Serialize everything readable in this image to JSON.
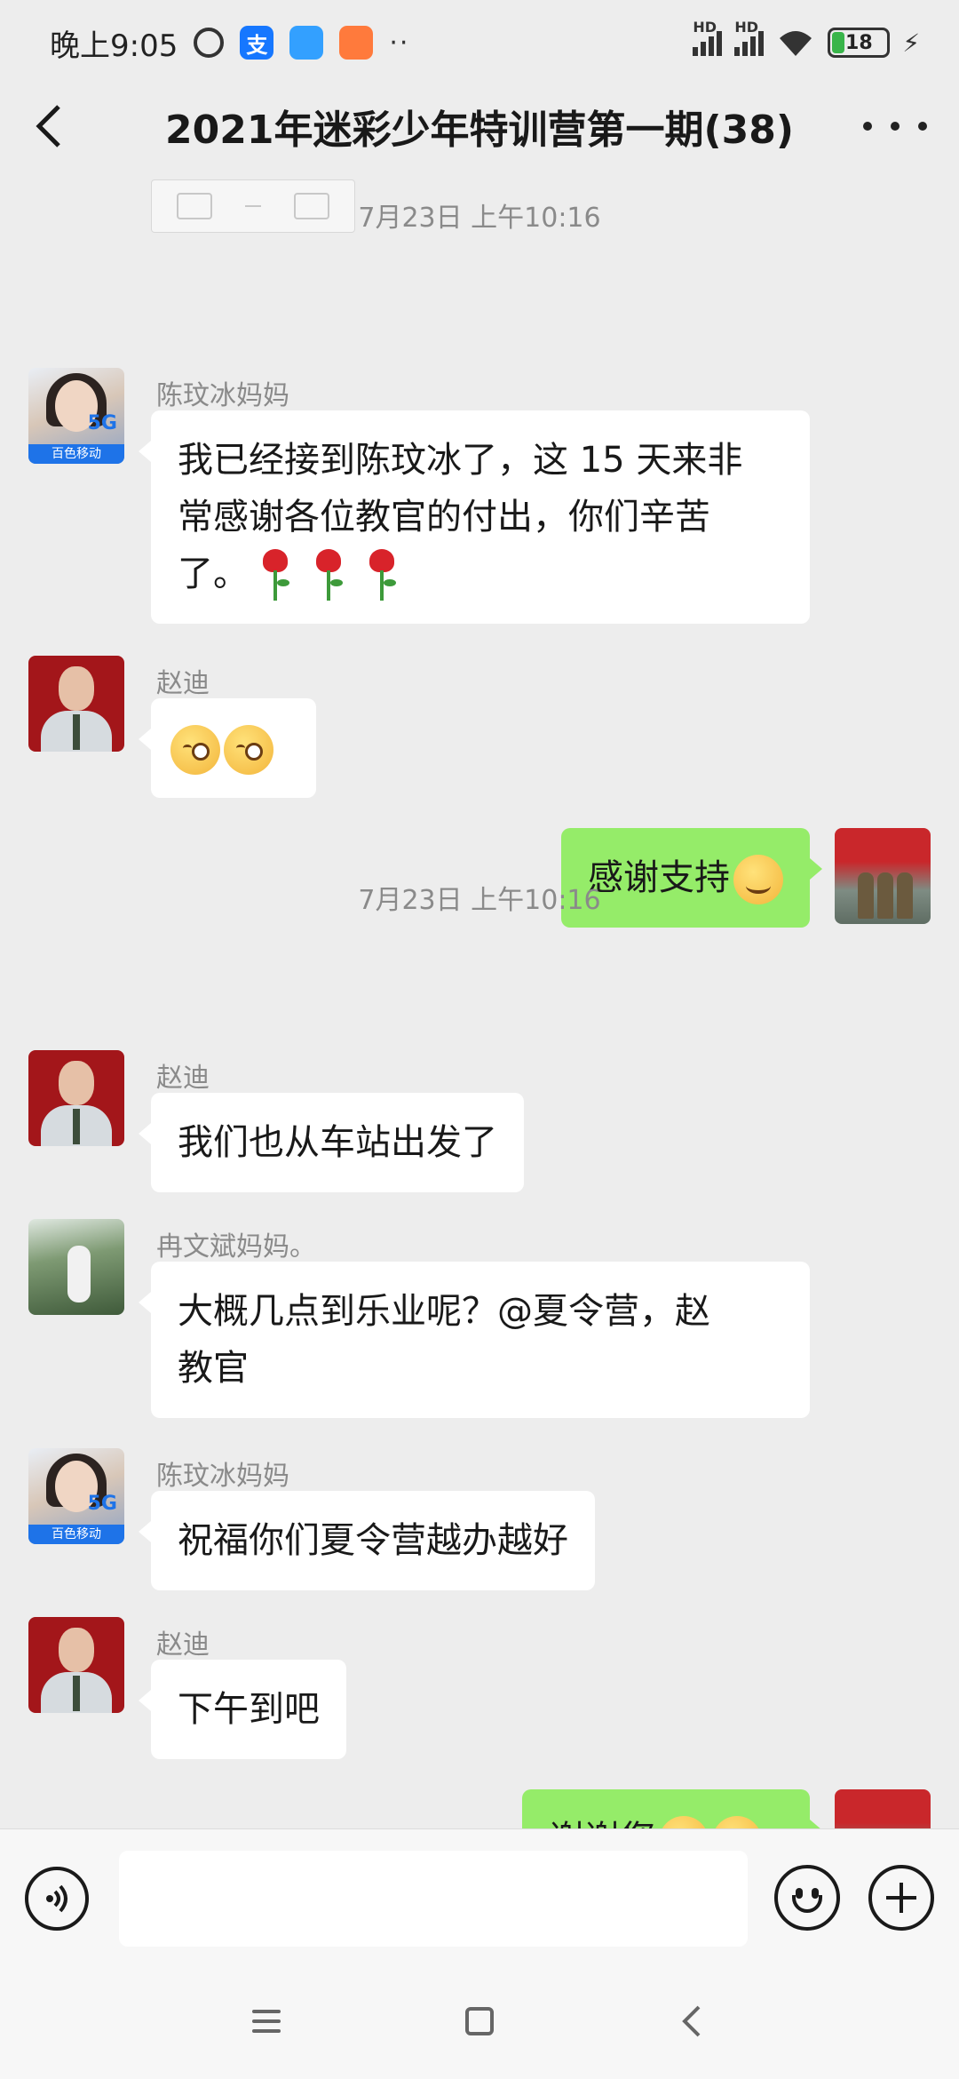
{
  "status_bar": {
    "time": "晚上9:05",
    "notification_dots": "··",
    "signal1_label": "HD",
    "signal2_label": "HD",
    "battery": "18",
    "charging_symbol": "⚡"
  },
  "nav": {
    "title": "2021年迷彩少年特训营第一期(38)"
  },
  "chat": {
    "timestamp1": "7月23日 上午10:16",
    "timestamp2": "7月23日 上午10:16",
    "messages": [
      {
        "sender": "陈玟冰妈妈",
        "text_part1": "我已经接到陈玟冰了，这 15 天来非",
        "text_part2": "常感谢各位教官的付出，你们辛苦",
        "text_part3": "了。"
      },
      {
        "sender": "赵迪"
      },
      {
        "text": "感谢支持"
      },
      {
        "sender": "赵迪",
        "text": "我们也从车站出发了"
      },
      {
        "sender": "冉文斌妈妈。",
        "text_part1": "大概几点到乐业呢？@夏令营，赵",
        "text_part2": "教官"
      },
      {
        "sender": "陈玟冰妈妈",
        "text": "祝福你们夏令营越办越好"
      },
      {
        "sender": "赵迪",
        "text": "下午到吧"
      },
      {
        "text": "谢谢您"
      }
    ],
    "avatar_badge": "百色移动",
    "avatar_5g": "5G"
  },
  "input": {
    "placeholder": ""
  },
  "colors": {
    "background": "#ededed",
    "bubble_self": "#95ec69",
    "bubble_other": "#ffffff",
    "timestamp": "#8a8a8a"
  },
  "icons": [
    "clock-icon",
    "alipay-icon",
    "app-icon",
    "taobao-icon",
    "signal-icon",
    "wifi-icon",
    "battery-icon",
    "back-icon",
    "more-icon",
    "voice-icon",
    "emoji-icon",
    "plus-icon",
    "menu-icon",
    "home-icon",
    "nav-back-icon"
  ]
}
